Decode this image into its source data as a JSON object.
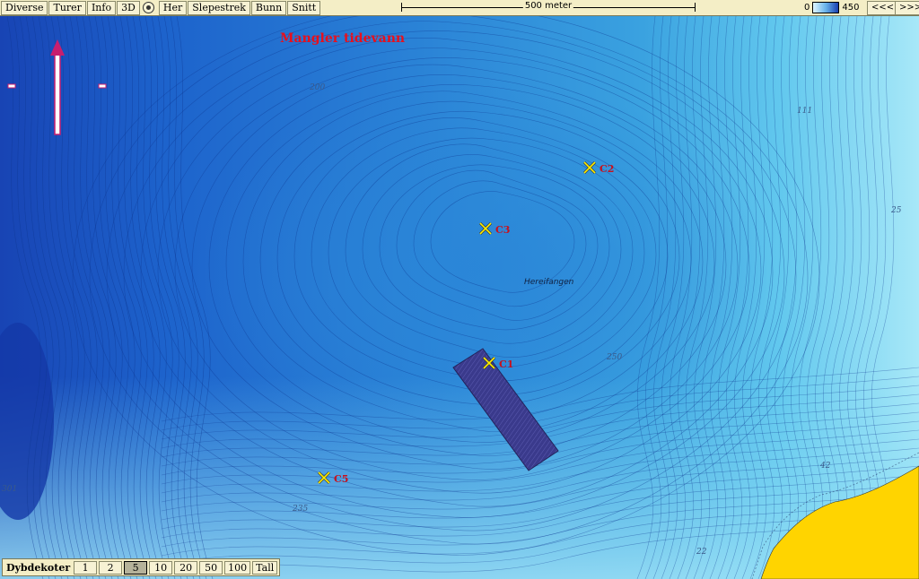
{
  "toolbar": {
    "menu_items": [
      "Diverse",
      "Turer",
      "Info",
      "3D",
      "Her",
      "Slepestrek",
      "Bunn",
      "Snitt"
    ],
    "scale_label": "500 meter",
    "depth_min": "0",
    "depth_max": "450",
    "nav_prev": "<<<",
    "nav_next": ">>>"
  },
  "map": {
    "warning": "Mangler tidevann",
    "place_name": "Hereifangen",
    "depth_labels": [
      "200",
      "111",
      "25",
      "250",
      "42",
      "22",
      "235",
      "301"
    ],
    "markers": [
      "C1",
      "C2",
      "C3",
      "C5"
    ],
    "colors": {
      "deep": "#1a3fb0",
      "shallow": "#bfeefc",
      "land": "#ffd400",
      "tow_area": "#3a3a8c",
      "marker": "#ffee00",
      "marker_label": "#c8101c"
    }
  },
  "depth_contours": {
    "label": "Dybdekoter",
    "options": [
      "1",
      "2",
      "5",
      "10",
      "20",
      "50",
      "100",
      "Tall"
    ],
    "selected": "5"
  }
}
